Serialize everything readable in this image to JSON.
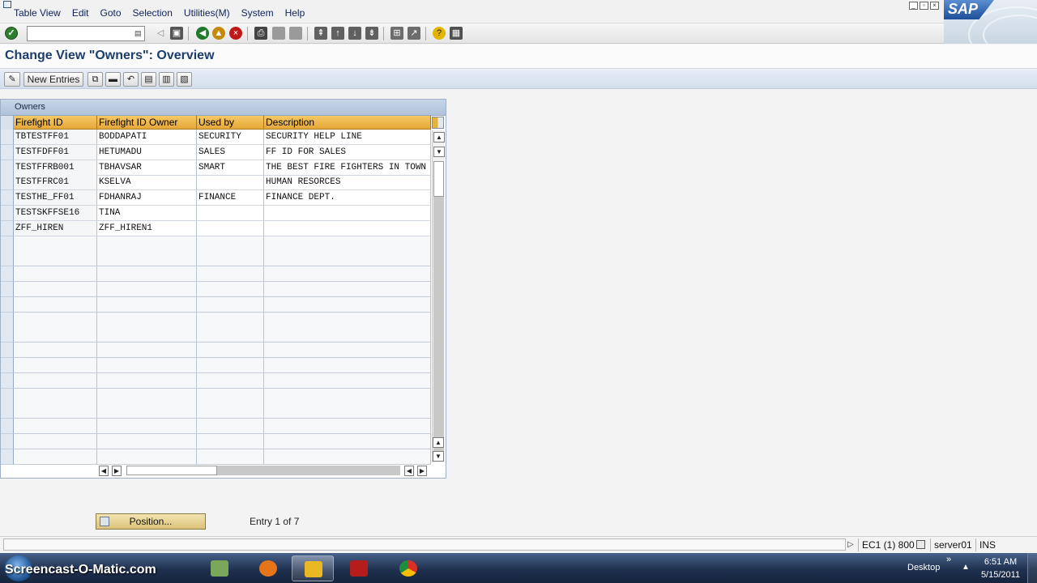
{
  "menu": [
    "Table View",
    "Edit",
    "Goto",
    "Selection",
    "Utilities(M)",
    "System",
    "Help"
  ],
  "brand": "SAP",
  "command_field": {
    "value": ""
  },
  "title": "Change View \"Owners\": Overview",
  "app_toolbar": {
    "new_entries": "New Entries"
  },
  "table": {
    "title": "Owners",
    "columns": [
      "Firefight ID",
      "Firefight ID Owner",
      "Used by",
      "Description"
    ],
    "rows": [
      [
        "TBTESTFF01",
        "BODDAPATI",
        "SECURITY",
        "SECURITY HELP LINE"
      ],
      [
        "TESTFDFF01",
        "HETUMADU",
        "SALES",
        "FF ID FOR SALES"
      ],
      [
        "TESTFFRB001",
        "TBHAVSAR",
        "SMART",
        "THE BEST FIRE FIGHTERS IN TOWN"
      ],
      [
        "TESTFFRC01",
        "KSELVA",
        "",
        "HUMAN RESORCES"
      ],
      [
        "TESTHE_FF01",
        "FDHANRAJ",
        "FINANCE",
        "FINANCE DEPT."
      ],
      [
        "TESTSKFFSE16",
        "TINA",
        "",
        ""
      ],
      [
        "ZFF_HIREN",
        "ZFF_HIREN1",
        "",
        ""
      ]
    ],
    "empty_rows": 15
  },
  "position_button": "Position...",
  "entry_info": "Entry 1 of 7",
  "status": {
    "system": "EC1 (1) 800",
    "server": "server01",
    "mode": "INS"
  },
  "taskbar": {
    "watermark": "Screencast-O-Matic.com",
    "desktop": "Desktop",
    "time": "6:51 AM",
    "date": "5/15/2011"
  },
  "colors": {
    "title_text": "#1d3d6b",
    "column_header": "#e6a839",
    "taskbar": "#1f3150"
  }
}
